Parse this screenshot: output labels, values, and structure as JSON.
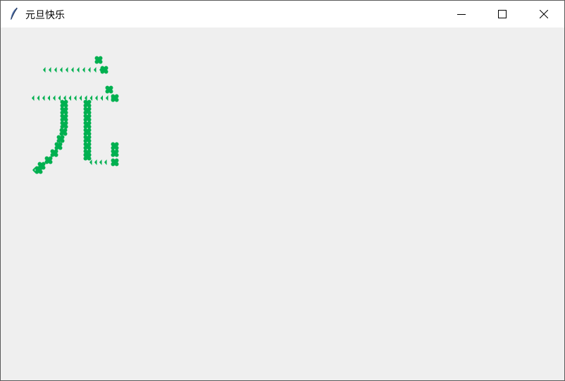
{
  "window": {
    "title": "元旦快乐",
    "app_icon": "feather-icon",
    "controls": {
      "minimize_icon": "minimize-icon",
      "maximize_icon": "maximize-icon",
      "close_icon": "close-icon"
    }
  },
  "canvas": {
    "background": "#efefef",
    "clover_color": "#00b050",
    "drawn_character": "元",
    "glyph_icon": "clover-icon"
  }
}
